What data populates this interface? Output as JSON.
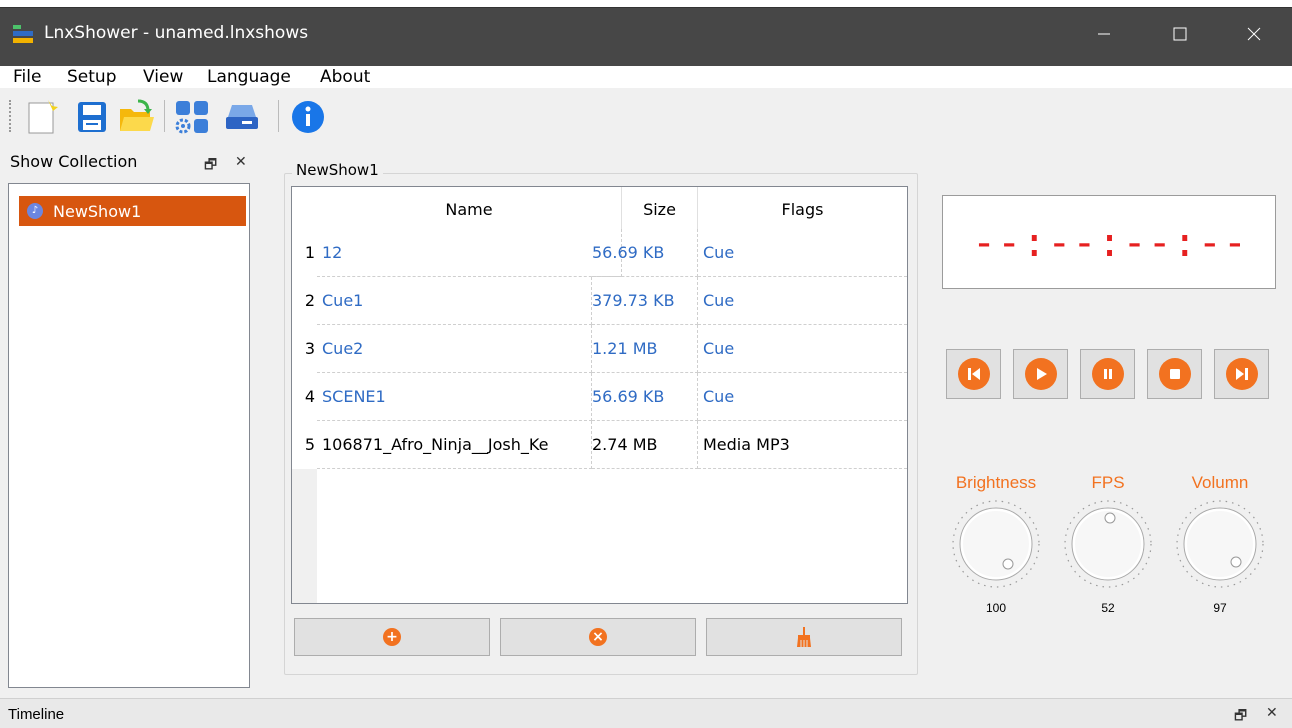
{
  "window": {
    "title": "LnxShower - unamed.lnxshows",
    "minimize": "—",
    "maximize": "☐",
    "close": "✕"
  },
  "menu": [
    "File",
    "Setup",
    "View",
    "Language",
    "About"
  ],
  "toolbar": {
    "icons": [
      "new-file-icon",
      "save-icon",
      "open-folder-icon",
      "settings-grid-icon",
      "device-icon",
      "info-icon"
    ]
  },
  "collection": {
    "title": "Show Collection",
    "float": "🗗",
    "close": "✕",
    "items": [
      {
        "label": "NewShow1"
      }
    ]
  },
  "show": {
    "title": "NewShow1",
    "columns": [
      "Name",
      "Size",
      "Flags"
    ],
    "rows": [
      {
        "num": "1",
        "name": "12",
        "size": "56.69 KB",
        "flags": "Cue",
        "cue": true
      },
      {
        "num": "2",
        "name": "Cue1",
        "size": "379.73 KB",
        "flags": "Cue",
        "cue": true
      },
      {
        "num": "3",
        "name": "Cue2",
        "size": "1.21 MB",
        "flags": "Cue",
        "cue": true
      },
      {
        "num": "4",
        "name": "SCENE1",
        "size": "56.69 KB",
        "flags": "Cue",
        "cue": true
      },
      {
        "num": "5",
        "name": "106871_Afro_Ninja__Josh_Ke",
        "size": "2.74 MB",
        "flags": "Media MP3",
        "cue": false
      }
    ],
    "actions": [
      "add-icon",
      "remove-icon",
      "clear-icon"
    ]
  },
  "timecode": "--:--:--:--",
  "transport": [
    "skip-back-icon",
    "play-icon",
    "pause-icon",
    "stop-icon",
    "skip-forward-icon"
  ],
  "knobs": [
    {
      "label": "Brightness",
      "value": "100"
    },
    {
      "label": "FPS",
      "value": "52"
    },
    {
      "label": "Volumn",
      "value": "97"
    }
  ],
  "timeline": {
    "title": "Timeline",
    "float": "🗗",
    "close": "✕"
  },
  "colors": {
    "accent": "#f27220",
    "selection": "#d7560f",
    "cue_text": "#2f6bc4",
    "timecode": "#e62020"
  }
}
